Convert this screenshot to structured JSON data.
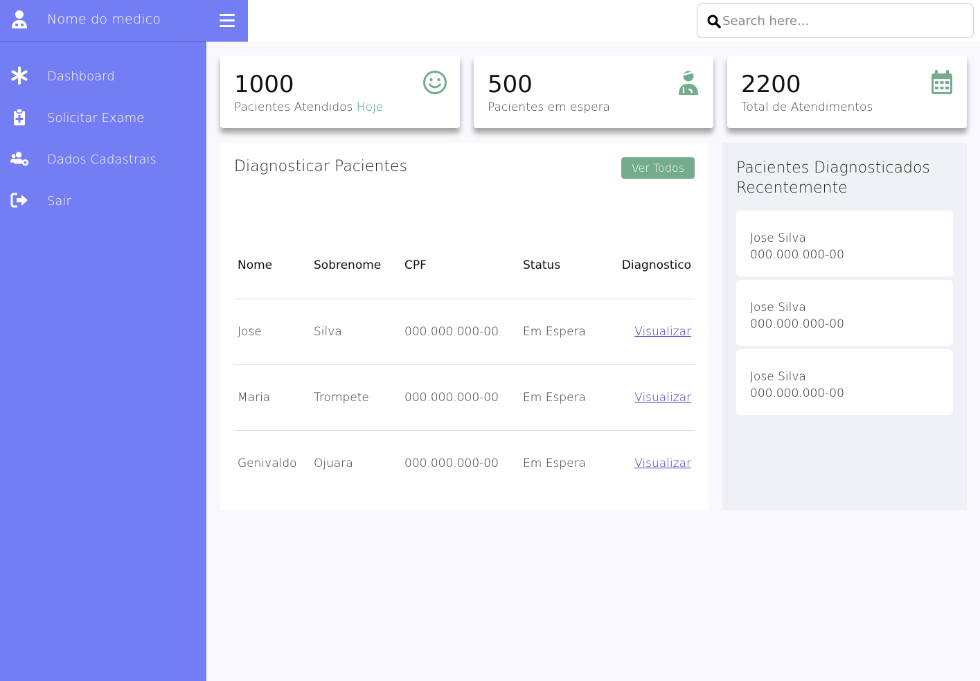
{
  "sidebar": {
    "brand_name": "Nome do medico",
    "items": [
      {
        "label": "Dashboard",
        "icon": "asterisk-icon"
      },
      {
        "label": "Solicitar Exame",
        "icon": "clipboard-plus-icon"
      },
      {
        "label": "Dados Cadastrais",
        "icon": "users-cog-icon"
      },
      {
        "label": "Sair",
        "icon": "sign-out-icon"
      }
    ]
  },
  "search": {
    "placeholder": "Search here..."
  },
  "cards": [
    {
      "number": "1000",
      "label": "Pacientes Atendidos",
      "highlight": "Hoje",
      "icon": "smile-icon"
    },
    {
      "number": "500",
      "label": "Pacientes em espera",
      "icon": "user-injured-icon"
    },
    {
      "number": "2200",
      "label": "Total de Atendimentos",
      "icon": "calendar-icon"
    }
  ],
  "diagnosticar": {
    "title": "Diagnosticar Pacientes",
    "button": "Ver Todos",
    "columns": [
      "Nome",
      "Sobrenome",
      "CPF",
      "Status",
      "Diagnostico"
    ],
    "rows": [
      {
        "nome": "Jose",
        "sobrenome": "Silva",
        "cpf": "000.000.000-00",
        "status": "Em Espera",
        "link": "Visualizar"
      },
      {
        "nome": "Maria",
        "sobrenome": "Trompete",
        "cpf": "000.000.000-00",
        "status": "Em Espera",
        "link": "Visualizar"
      },
      {
        "nome": "Genivaldo",
        "sobrenome": "Ojuara",
        "cpf": "000.000.000-00",
        "status": "Em Espera",
        "link": "Visualizar"
      }
    ]
  },
  "recentes": {
    "title": "Pacientes Diagnosticados Recentemente",
    "items": [
      {
        "name": "Jose Silva",
        "cpf": "000.000.000-00"
      },
      {
        "name": "Jose Silva",
        "cpf": "000.000.000-00"
      },
      {
        "name": "Jose Silva",
        "cpf": "000.000.000-00"
      }
    ]
  },
  "colors": {
    "sidebar": "#737df4",
    "accent_green": "#75ac8d",
    "highlight": "#3a9a8f",
    "link": "#3b39c5"
  }
}
